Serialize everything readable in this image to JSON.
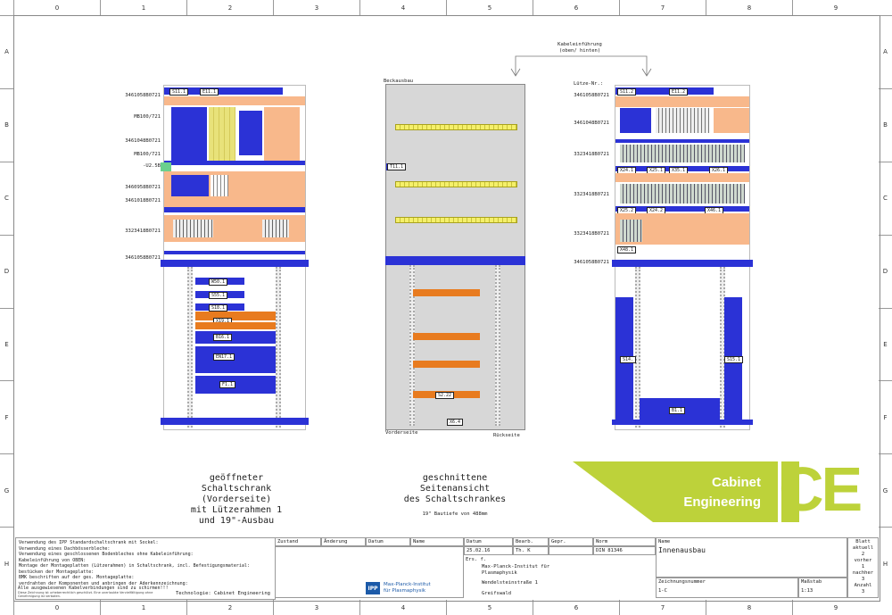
{
  "ruler": {
    "columns": [
      "0",
      "1",
      "2",
      "3",
      "4",
      "5",
      "6",
      "7",
      "8",
      "9"
    ],
    "rows": [
      "A",
      "B",
      "C",
      "D",
      "E",
      "F",
      "G",
      "H"
    ]
  },
  "cable_entry": {
    "label_line1": "Kabeleinführung",
    "label_line2": "(oben/ hinten)"
  },
  "front_view": {
    "component_labels": [
      "3461058B0721",
      "MB100/721",
      "3461048B0721",
      "MB100/721",
      "-U2.5B",
      "3460958B0721",
      "3461018B0721",
      "3323418B0721",
      "3461058B0721"
    ],
    "tags": [
      "S11.1",
      "E11.1",
      "W50.1",
      "S55.1",
      "S18.1",
      "X19.1",
      "B16.1",
      "EN17.1",
      "F1.1"
    ]
  },
  "side_view": {
    "top_label": "Beckausbau",
    "tags": [
      "T11.1",
      "X6.4",
      "S2.22"
    ],
    "bottom_left": "Vorderseite",
    "bottom_right": "Rückseite"
  },
  "lutz_view": {
    "title": "Lütze-Nr.:",
    "component_labels": [
      "3461058B0721",
      "3461048B0721",
      "3323418B0721",
      "3323418B0721",
      "3323418B0721",
      "3461058B0721"
    ],
    "tags": [
      "S11.2",
      "E11.2",
      "X24.1",
      "X25.1",
      "X35.1",
      "X26.1",
      "X24.2",
      "X25.2",
      "X26.2",
      "X46.1",
      "X48.1",
      "S14.",
      "S15.1",
      "B1.1"
    ]
  },
  "captions": {
    "front": [
      "geöffneter",
      "Schaltschrank",
      "(Vorderseite)",
      "mit Lützerahmen 1",
      "und 19\"-Ausbau"
    ],
    "side": [
      "geschnittene",
      "Seitenansicht",
      "des Schaltschrankes"
    ],
    "side_note": "19\" Bautiefe von 488mm"
  },
  "logo": {
    "line1": "Cabinet",
    "line2": "Engineering",
    "mark": "CE",
    "colors": {
      "green": "#bdd23a",
      "white": "#ffffff"
    }
  },
  "notes": [
    "Verwendung des IPP Standardschaltschrank mit Sockel:",
    "Verwendung eines Dachbösserbleche:",
    "Verwendung eines geschlossenen Bodenbleches ohne Kabeleinführung:",
    "Kabeleinführung von OBEN:",
    "Montage der Montageplatten (Lützerahmen) in Schaltschrank, incl. Befestigungsmaterial:",
    "bestücken der Montageplatte:",
    "BMK beschriften auf der ges. Montageplatte:",
    "verdrahten der Komponenten und anbringen der Aderkennzeichnung:",
    "Alle ausgewiesenen Kabelverbindungen sind zu schirmen!!!"
  ],
  "notes_small": "Diese Zeichnung ist urheberrechtlich geschützt. Eine unerlaubte Vervielfältigung ohne Genehmigung ist verboten.",
  "title_block": {
    "headers": [
      "Zustand",
      "Änderung",
      "Datum",
      "Name"
    ],
    "date_header": "Datum",
    "bearb_header": "Bearb.",
    "gepr_header": "Gepr.",
    "norm_header": "Norm",
    "date": "25.02.16",
    "bearb": "Th. K",
    "norm": "DIN 81346",
    "ers": "Ers. f.",
    "institute": [
      "Max-Planck-Institut für",
      "Plasmaphysik"
    ],
    "street": "Wendelsteinstraße 1",
    "city": "Greifswald",
    "logo_text": [
      "Max-Planck-Institut",
      "für Plasmaphysik"
    ],
    "logo_mark": "IPP",
    "technology": "Technologie: Cabinet Engineering",
    "name_label": "Name",
    "name_value": "Innenausbau",
    "drawing_number_label": "Zeichnungsnummer",
    "drawing_number": "1-C",
    "scale_label": "Maßstab",
    "scale": "1:13",
    "sheet_label": "Blatt",
    "sheet_info": [
      "aktuell",
      "2",
      "vorher",
      "1",
      "nachher",
      "3",
      "Anzahl",
      "3"
    ]
  }
}
